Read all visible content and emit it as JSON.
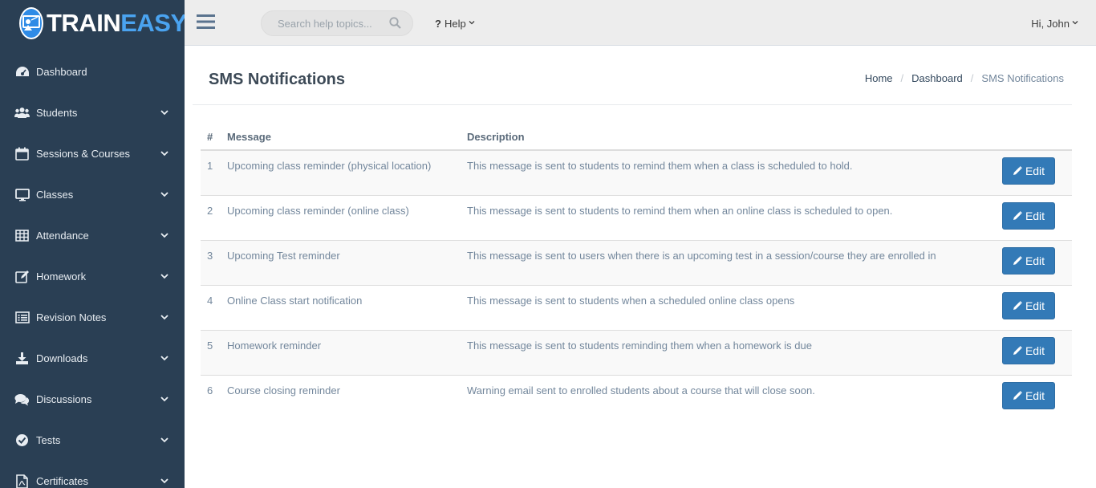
{
  "brand": {
    "part1": "TRAIN",
    "part2": "EASY"
  },
  "sidebar": {
    "items": [
      {
        "label": "Dashboard",
        "icon": "dashboard-icon",
        "has_submenu": false
      },
      {
        "label": "Students",
        "icon": "users-icon",
        "has_submenu": true
      },
      {
        "label": "Sessions & Courses",
        "icon": "calendar-icon",
        "has_submenu": true
      },
      {
        "label": "Classes",
        "icon": "desktop-icon",
        "has_submenu": true
      },
      {
        "label": "Attendance",
        "icon": "table-icon",
        "has_submenu": true
      },
      {
        "label": "Homework",
        "icon": "edit-icon",
        "has_submenu": true
      },
      {
        "label": "Revision Notes",
        "icon": "list-icon",
        "has_submenu": true
      },
      {
        "label": "Downloads",
        "icon": "download-icon",
        "has_submenu": true
      },
      {
        "label": "Discussions",
        "icon": "comments-icon",
        "has_submenu": true
      },
      {
        "label": "Tests",
        "icon": "check-circle-icon",
        "has_submenu": true
      },
      {
        "label": "Certificates",
        "icon": "file-pdf-icon",
        "has_submenu": true
      }
    ]
  },
  "topbar": {
    "search_placeholder": "Search help topics...",
    "help_label": "Help",
    "user_greeting": "Hi, John"
  },
  "page": {
    "title": "SMS Notifications",
    "breadcrumb": [
      "Home",
      "Dashboard",
      "SMS Notifications"
    ]
  },
  "table": {
    "headers": [
      "#",
      "Message",
      "Description"
    ],
    "edit_label": "Edit",
    "rows": [
      {
        "num": "1",
        "message": "Upcoming class reminder (physical location)",
        "description": "This message is sent to students to remind them when a class is scheduled to hold."
      },
      {
        "num": "2",
        "message": "Upcoming class reminder (online class)",
        "description": "This message is sent to students to remind them when an online class is scheduled to open."
      },
      {
        "num": "3",
        "message": "Upcoming Test reminder",
        "description": "This message is sent to users when there is an upcoming test in a session/course they are enrolled in"
      },
      {
        "num": "4",
        "message": "Online Class start notification",
        "description": "This message is sent to students when a scheduled online class opens"
      },
      {
        "num": "5",
        "message": "Homework reminder",
        "description": "This message is sent to students reminding them when a homework is due"
      },
      {
        "num": "6",
        "message": "Course closing reminder",
        "description": "Warning email sent to enrolled students about a course that will close soon."
      }
    ]
  },
  "colors": {
    "sidebar_bg": "#2a3f54",
    "topbar_bg": "#ededed",
    "primary_button": "#337ab7",
    "logo_accent": "#4aa3f0"
  }
}
